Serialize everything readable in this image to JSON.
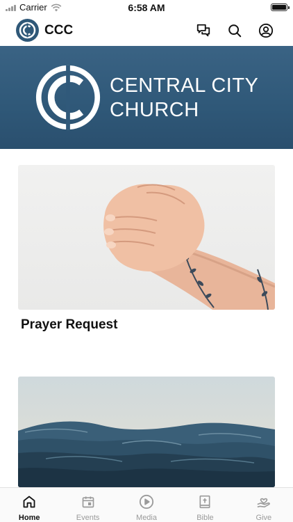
{
  "status_bar": {
    "carrier": "Carrier",
    "time": "6:58 AM"
  },
  "header": {
    "app_title": "CCC",
    "icons": [
      "chat-icon",
      "search-icon",
      "account-icon"
    ]
  },
  "hero": {
    "line1": "CENTRAL CITY",
    "line2": "CHURCH",
    "background_color": "#2f5878"
  },
  "cards": [
    {
      "title": "Prayer Request",
      "image": "praying-hands"
    },
    {
      "title": "",
      "image": "ocean-waves"
    }
  ],
  "tab_bar": {
    "active_color": "#111111",
    "inactive_color": "#9a9a9a",
    "tabs": [
      {
        "label": "Home",
        "icon": "home-icon",
        "active": true
      },
      {
        "label": "Events",
        "icon": "calendar-icon",
        "active": false
      },
      {
        "label": "Media",
        "icon": "play-icon",
        "active": false
      },
      {
        "label": "Bible",
        "icon": "bible-icon",
        "active": false
      },
      {
        "label": "Give",
        "icon": "give-icon",
        "active": false
      }
    ]
  }
}
